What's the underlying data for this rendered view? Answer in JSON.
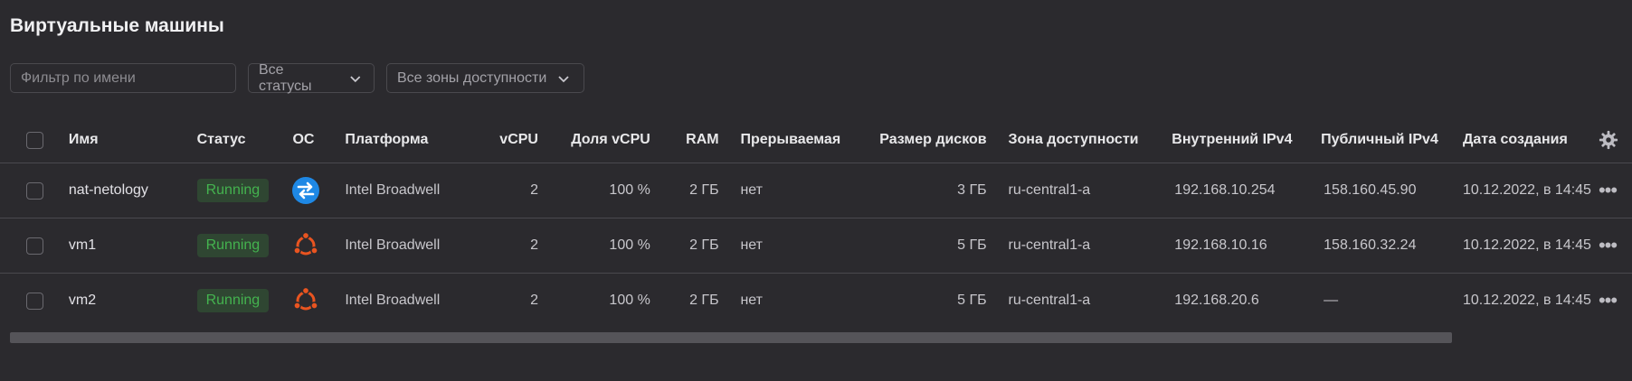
{
  "page": {
    "title": "Виртуальные машины"
  },
  "filters": {
    "search_placeholder": "Фильтр по имени",
    "status_select": "Все статусы",
    "zone_select": "Все зоны доступности"
  },
  "table": {
    "columns": {
      "name": "Имя",
      "status": "Статус",
      "os": "ОС",
      "platform": "Платформа",
      "vcpu": "vCPU",
      "vcpu_share": "Доля vCPU",
      "ram": "RAM",
      "preemptible": "Прерываемая",
      "disk_size": "Размер дисков",
      "zone": "Зона доступности",
      "internal_ip": "Внутренний IPv4",
      "public_ip": "Публичный IPv4",
      "created": "Дата создания"
    },
    "rows": [
      {
        "name": "nat-netology",
        "status": "Running",
        "os_icon": "nat-instance-icon",
        "platform": "Intel Broadwell",
        "vcpu": "2",
        "vcpu_share": "100 %",
        "ram": "2 ГБ",
        "preemptible": "нет",
        "disk_size": "3 ГБ",
        "zone": "ru-central1-a",
        "internal_ip": "192.168.10.254",
        "public_ip": "158.160.45.90",
        "created": "10.12.2022, в 14:45"
      },
      {
        "name": "vm1",
        "status": "Running",
        "os_icon": "ubuntu-icon",
        "platform": "Intel Broadwell",
        "vcpu": "2",
        "vcpu_share": "100 %",
        "ram": "2 ГБ",
        "preemptible": "нет",
        "disk_size": "5 ГБ",
        "zone": "ru-central1-a",
        "internal_ip": "192.168.10.16",
        "public_ip": "158.160.32.24",
        "created": "10.12.2022, в 14:45"
      },
      {
        "name": "vm2",
        "status": "Running",
        "os_icon": "ubuntu-icon",
        "platform": "Intel Broadwell",
        "vcpu": "2",
        "vcpu_share": "100 %",
        "ram": "2 ГБ",
        "preemptible": "нет",
        "disk_size": "5 ГБ",
        "zone": "ru-central1-a",
        "internal_ip": "192.168.20.6",
        "public_ip": "—",
        "created": "10.12.2022, в 14:45"
      }
    ]
  },
  "colors": {
    "background": "#2b2a2e",
    "status_running_text": "#44b34f",
    "status_running_bg": "#2f4632",
    "ubuntu_orange": "#e95420",
    "nat_blue": "#1e88e5"
  },
  "scrollbar": {
    "horizontal_visible_fraction": 0.88
  }
}
